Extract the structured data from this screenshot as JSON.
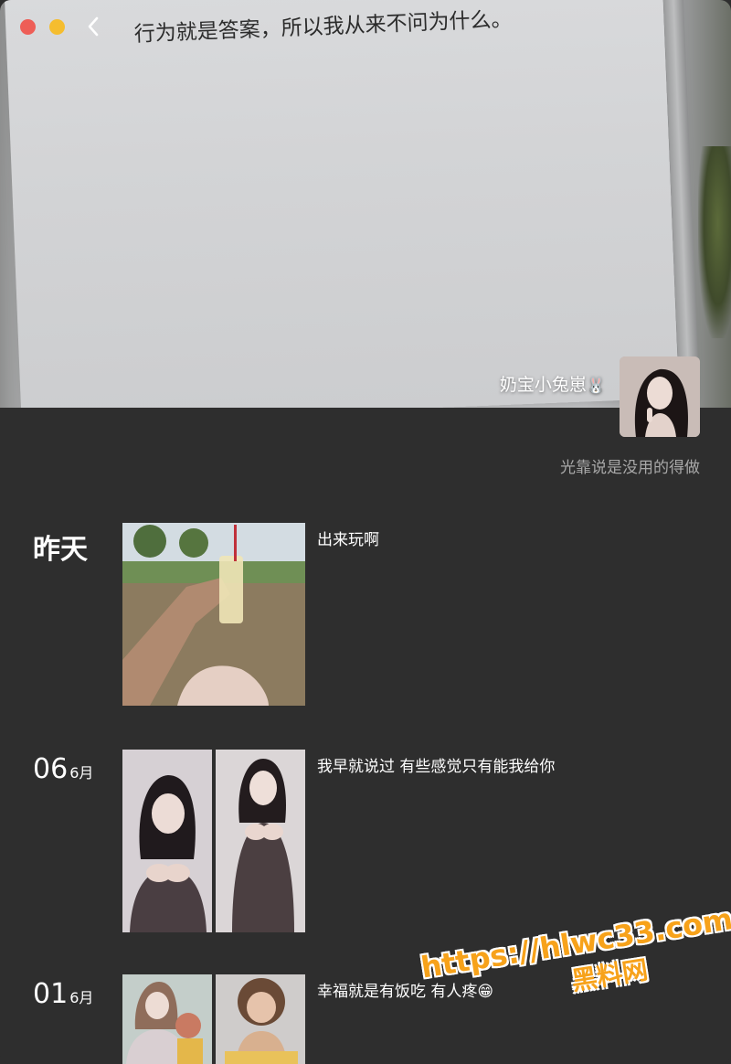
{
  "cover": {
    "quote": "行为就是答案，所以我从来不问为什么。"
  },
  "profile": {
    "username": "奶宝小兔崽",
    "username_emoji": "🐰",
    "signature": "光靠说是没用的得做"
  },
  "posts": [
    {
      "date_text": "昨天",
      "day": "",
      "month": "",
      "caption": "出来玩啊"
    },
    {
      "date_text": "",
      "day": "06",
      "month": "6月",
      "caption": "我早就说过 有些感觉只有能我给你"
    },
    {
      "date_text": "",
      "day": "01",
      "month": "6月",
      "caption": "幸福就是有饭吃 有人疼😁"
    }
  ],
  "watermark": {
    "url": "https://hlwc33.com",
    "brand": "黑料网"
  },
  "colors": {
    "background": "#2e2e2e",
    "close": "#ee5e57",
    "minimize": "#f5bd2f",
    "signature": "#a8a8a8",
    "watermark": "#f7a21a"
  },
  "icons": [
    "close-dot",
    "minimize-dot",
    "back-chevron-icon",
    "bunny-emoji-icon"
  ]
}
